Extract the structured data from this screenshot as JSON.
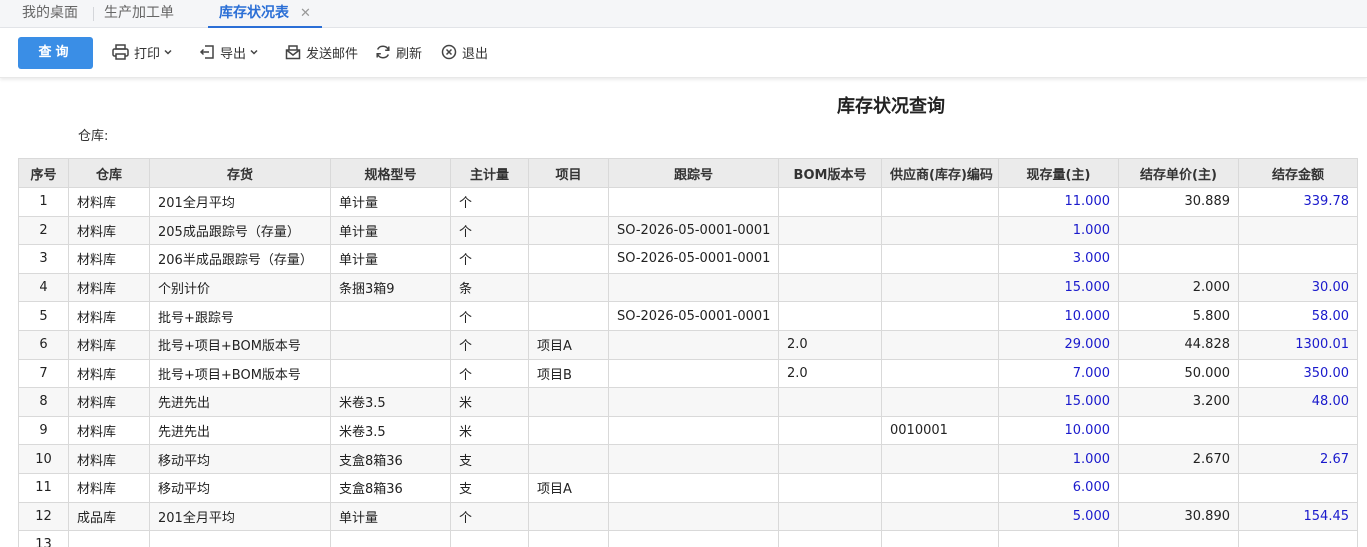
{
  "tabs": [
    {
      "label": "我的桌面",
      "active": false
    },
    {
      "label": "生产加工单",
      "active": false
    },
    {
      "label": "库存状况表",
      "active": true
    }
  ],
  "toolbar": {
    "query": "查询",
    "print": "打印",
    "export": "导出",
    "send_mail": "发送邮件",
    "refresh": "刷新",
    "exit": "退出"
  },
  "colors": {
    "accent": "#2b6fd6",
    "button": "#3a8ee6",
    "number_blue": "#1a1acc",
    "header_bg": "#ebebeb"
  },
  "report": {
    "title": "库存状况查询",
    "warehouse_label": "仓库:",
    "columns": [
      "序号",
      "仓库",
      "存货",
      "规格型号",
      "主计量",
      "项目",
      "跟踪号",
      "BOM版本号",
      "供应商(库存)编码",
      "现存量(主)",
      "结存单价(主)",
      "结存金额"
    ],
    "rows": [
      [
        "1",
        "材料库",
        "201全月平均",
        "单计量",
        "个",
        "",
        "",
        "",
        "",
        "11.000",
        "30.889",
        "339.78"
      ],
      [
        "2",
        "材料库",
        "205成品跟踪号（存量）",
        "单计量",
        "个",
        "",
        "SO-2026-05-0001-0001",
        "",
        "",
        "1.000",
        "",
        ""
      ],
      [
        "3",
        "材料库",
        "206半成品跟踪号（存量）",
        "单计量",
        "个",
        "",
        "SO-2026-05-0001-0001",
        "",
        "",
        "3.000",
        "",
        ""
      ],
      [
        "4",
        "材料库",
        "个别计价",
        "条捆3箱9",
        "条",
        "",
        "",
        "",
        "",
        "15.000",
        "2.000",
        "30.00"
      ],
      [
        "5",
        "材料库",
        "批号+跟踪号",
        "",
        "个",
        "",
        "SO-2026-05-0001-0001",
        "",
        "",
        "10.000",
        "5.800",
        "58.00"
      ],
      [
        "6",
        "材料库",
        "批号+项目+BOM版本号",
        "",
        "个",
        "项目A",
        "",
        "2.0",
        "",
        "29.000",
        "44.828",
        "1300.01"
      ],
      [
        "7",
        "材料库",
        "批号+项目+BOM版本号",
        "",
        "个",
        "项目B",
        "",
        "2.0",
        "",
        "7.000",
        "50.000",
        "350.00"
      ],
      [
        "8",
        "材料库",
        "先进先出",
        "米卷3.5",
        "米",
        "",
        "",
        "",
        "",
        "15.000",
        "3.200",
        "48.00"
      ],
      [
        "9",
        "材料库",
        "先进先出",
        "米卷3.5",
        "米",
        "",
        "",
        "",
        "0010001",
        "10.000",
        "",
        ""
      ],
      [
        "10",
        "材料库",
        "移动平均",
        "支盒8箱36",
        "支",
        "",
        "",
        "",
        "",
        "1.000",
        "2.670",
        "2.67"
      ],
      [
        "11",
        "材料库",
        "移动平均",
        "支盒8箱36",
        "支",
        "项目A",
        "",
        "",
        "",
        "6.000",
        "",
        ""
      ],
      [
        "12",
        "成品库",
        "201全月平均",
        "单计量",
        "个",
        "",
        "",
        "",
        "",
        "5.000",
        "30.890",
        "154.45"
      ],
      [
        "13",
        "",
        "",
        "",
        "",
        "",
        "",
        "",
        "",
        "",
        "",
        ""
      ]
    ]
  }
}
